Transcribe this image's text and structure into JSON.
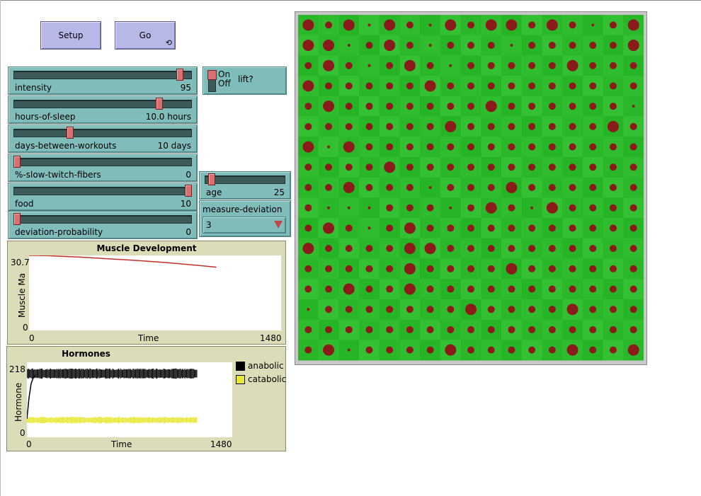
{
  "buttons": {
    "setup_label": "Setup",
    "go_label": "Go",
    "go_forever_icon": "forever-arrows-icon"
  },
  "sliders": [
    {
      "name": "intensity",
      "value_text": "95",
      "fraction": 0.95
    },
    {
      "name": "hours-of-sleep",
      "value_text": "10.0 hours",
      "fraction": 0.83
    },
    {
      "name": "days-between-workouts",
      "value_text": "10 days",
      "fraction": 0.31
    },
    {
      "name": "%-slow-twitch-fibers",
      "value_text": "0",
      "fraction": 0.0
    },
    {
      "name": "food",
      "value_text": "10",
      "fraction": 1.0
    },
    {
      "name": "deviation-probability",
      "value_text": "0",
      "fraction": 0.0
    },
    {
      "name": "age",
      "value_text": "25",
      "fraction": 0.05
    }
  ],
  "switch": {
    "name": "lift?",
    "on_label": "On",
    "off_label": "Off",
    "state": "on"
  },
  "chooser": {
    "name": "measure-deviation",
    "value": "3"
  },
  "colors": {
    "widget": "#7fbcba",
    "button": "#b8b8e8",
    "plot_bg": "#dcdcb8",
    "patch_green": "#2ab82a",
    "fiber_red": "#8b1a1a",
    "muscle_line": "#c0302a",
    "anabolic": "#000000",
    "catabolic": "#e8e830"
  },
  "chart_data": [
    {
      "type": "line",
      "title": "Muscle Development",
      "xlabel": "Time",
      "ylabel": "Muscle Ma",
      "xlim": [
        0,
        1480
      ],
      "ylim": [
        0,
        30.7
      ],
      "x_tick_labels": [
        "0",
        "1480"
      ],
      "y_tick_labels": [
        "0",
        "30.7"
      ],
      "series": [
        {
          "values_x": [
            0,
            100,
            200,
            300,
            400,
            500,
            600,
            700,
            800,
            900,
            1000,
            1100
          ],
          "values_y": [
            30.7,
            30.6,
            30.3,
            30.0,
            29.6,
            29.2,
            28.8,
            28.3,
            27.8,
            27.2,
            26.6,
            25.9
          ]
        }
      ],
      "grid": false
    },
    {
      "type": "line",
      "title": "Hormones",
      "xlabel": "Time",
      "ylabel": "Hormone",
      "xlim": [
        0,
        1480
      ],
      "ylim": [
        0,
        218
      ],
      "x_tick_labels": [
        "0",
        "1480"
      ],
      "y_tick_labels": [
        "0",
        "218"
      ],
      "legend_position": "right",
      "series": [
        {
          "name": "anabolic",
          "color": "#000000",
          "band_x": [
            0,
            1230
          ],
          "band_low": 170,
          "band_high": 200
        },
        {
          "name": "catabolic",
          "color": "#e8e830",
          "band_x": [
            0,
            1230
          ],
          "band_low": 40,
          "band_high": 60
        }
      ],
      "grid": false
    }
  ],
  "world": {
    "size": 17,
    "sizes": [
      [
        2,
        1,
        2,
        0,
        2,
        1,
        0,
        2,
        1,
        2,
        2,
        1,
        2,
        1,
        0,
        1,
        2
      ],
      [
        2,
        2,
        0,
        1,
        2,
        1,
        0,
        1,
        1,
        1,
        0,
        1,
        1,
        1,
        1,
        1,
        2
      ],
      [
        1,
        2,
        1,
        0,
        1,
        2,
        1,
        0,
        1,
        1,
        1,
        1,
        1,
        2,
        1,
        1,
        1
      ],
      [
        2,
        1,
        1,
        1,
        1,
        1,
        2,
        1,
        1,
        1,
        1,
        1,
        1,
        1,
        1,
        1,
        1
      ],
      [
        1,
        2,
        1,
        1,
        1,
        1,
        1,
        1,
        1,
        2,
        1,
        1,
        1,
        1,
        1,
        1,
        0
      ],
      [
        1,
        1,
        1,
        1,
        1,
        1,
        1,
        2,
        1,
        1,
        1,
        1,
        1,
        1,
        1,
        2,
        1
      ],
      [
        2,
        0,
        2,
        1,
        1,
        1,
        1,
        1,
        1,
        1,
        1,
        1,
        1,
        1,
        1,
        1,
        1
      ],
      [
        1,
        1,
        1,
        1,
        2,
        1,
        1,
        1,
        1,
        1,
        1,
        1,
        1,
        1,
        1,
        1,
        1
      ],
      [
        1,
        1,
        2,
        1,
        1,
        1,
        0,
        1,
        1,
        1,
        2,
        1,
        1,
        1,
        1,
        1,
        1
      ],
      [
        1,
        0,
        0,
        0,
        1,
        1,
        1,
        0,
        1,
        2,
        1,
        0,
        2,
        1,
        1,
        1,
        1
      ],
      [
        1,
        2,
        1,
        0,
        1,
        2,
        1,
        1,
        1,
        1,
        1,
        1,
        1,
        1,
        1,
        1,
        1
      ],
      [
        2,
        1,
        1,
        1,
        1,
        2,
        2,
        1,
        1,
        1,
        1,
        1,
        1,
        1,
        1,
        1,
        1
      ],
      [
        1,
        1,
        1,
        1,
        1,
        2,
        1,
        1,
        1,
        1,
        2,
        1,
        1,
        1,
        1,
        1,
        1
      ],
      [
        1,
        1,
        2,
        1,
        1,
        2,
        1,
        1,
        1,
        1,
        1,
        1,
        1,
        1,
        1,
        1,
        1
      ],
      [
        0,
        1,
        1,
        1,
        1,
        1,
        1,
        1,
        2,
        1,
        1,
        1,
        1,
        2,
        1,
        1,
        1
      ],
      [
        1,
        1,
        1,
        1,
        1,
        1,
        1,
        1,
        1,
        1,
        1,
        1,
        1,
        1,
        1,
        1,
        1
      ],
      [
        1,
        2,
        0,
        1,
        1,
        1,
        1,
        2,
        1,
        1,
        1,
        1,
        1,
        2,
        1,
        1,
        2
      ]
    ]
  }
}
